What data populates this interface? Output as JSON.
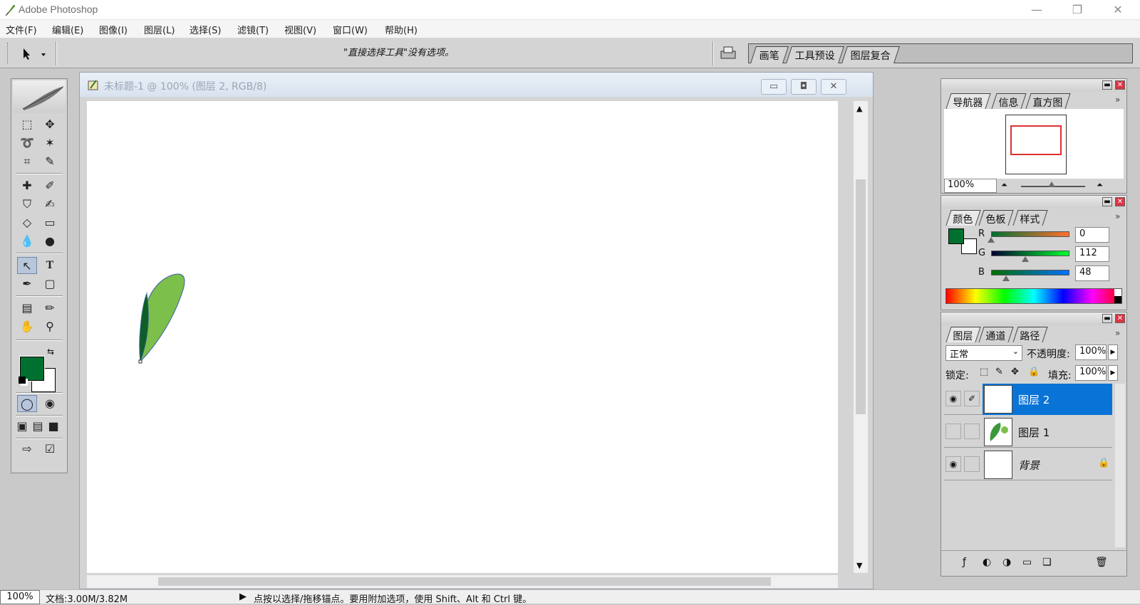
{
  "app": {
    "title": "Adobe Photoshop"
  },
  "menu": [
    "文件(F)",
    "编辑(E)",
    "图像(I)",
    "图层(L)",
    "选择(S)",
    "滤镜(T)",
    "视图(V)",
    "窗口(W)",
    "帮助(H)"
  ],
  "options": {
    "hint": "\"直接选择工具\"没有选项。"
  },
  "palette_well": {
    "tabs": [
      "画笔",
      "工具预设",
      "图层复合"
    ]
  },
  "document": {
    "title": "未标题-1 @ 100% (图层 2, RGB/8)"
  },
  "navigator": {
    "tabs": [
      "导航器",
      "信息",
      "直方图"
    ],
    "zoom": "100%"
  },
  "color": {
    "tabs": [
      "颜色",
      "色板",
      "样式"
    ],
    "channels": [
      {
        "label": "R",
        "value": "0"
      },
      {
        "label": "G",
        "value": "112"
      },
      {
        "label": "B",
        "value": "48"
      }
    ],
    "foreground": "#007030",
    "background": "#ffffff"
  },
  "layers": {
    "tabs": [
      "图层",
      "通道",
      "路径"
    ],
    "blend_mode": "正常",
    "opacity_label": "不透明度:",
    "opacity": "100%",
    "lock_label": "锁定:",
    "fill_label": "填充:",
    "fill": "100%",
    "items": [
      {
        "name": "图层 2",
        "selected": true,
        "visible": true
      },
      {
        "name": "图层 1",
        "selected": false,
        "visible": false
      },
      {
        "name": "背景",
        "selected": false,
        "visible": true,
        "locked": true
      }
    ]
  },
  "status": {
    "zoom": "100%",
    "doc_size": "文档:3.00M/3.82M",
    "message": "点按以选择/拖移锚点。要用附加选项，使用 Shift、Alt 和 Ctrl 键。"
  },
  "colors": {
    "selection_blue": "#0a74d6",
    "leaf_light": "#7cbf4a",
    "leaf_dark": "#0e5e2a"
  }
}
